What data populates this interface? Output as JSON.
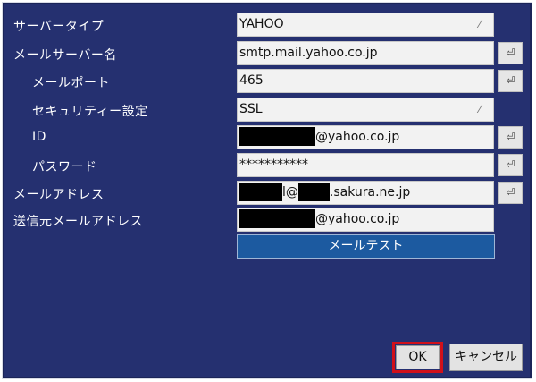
{
  "rows": [
    {
      "label": "サーバータイプ",
      "value": "YAHOO",
      "dropdown": true
    },
    {
      "label": "メールサーバー名",
      "value": "smtp.mail.yahoo.co.jp",
      "keyboard": true
    },
    {
      "label": "メールポート",
      "value": "465",
      "keyboard": true
    },
    {
      "label": "セキュリティー設定",
      "value": "SSL",
      "dropdown": true
    },
    {
      "label": "ID",
      "value_suffix": "@yahoo.co.jp",
      "keyboard": true
    },
    {
      "label": "パスワード",
      "value": "***********",
      "keyboard": true
    },
    {
      "label": "メールアドレス",
      "value_part": "l@",
      "value_suffix": ".sakura.ne.jp",
      "keyboard": true
    },
    {
      "label": "送信元メールアドレス",
      "value_suffix": "@yahoo.co.jp"
    }
  ],
  "buttons": {
    "mail_test": "メールテスト",
    "ok": "OK",
    "cancel": "キャンセル"
  },
  "icons": {
    "dropdown": "dropdown-arrow-icon",
    "keyboard": "keyboard-icon"
  },
  "colors": {
    "background": "#253070",
    "field_bg": "#f2f2f2",
    "test_button": "#1c5aa0",
    "highlight": "#d0101a"
  }
}
